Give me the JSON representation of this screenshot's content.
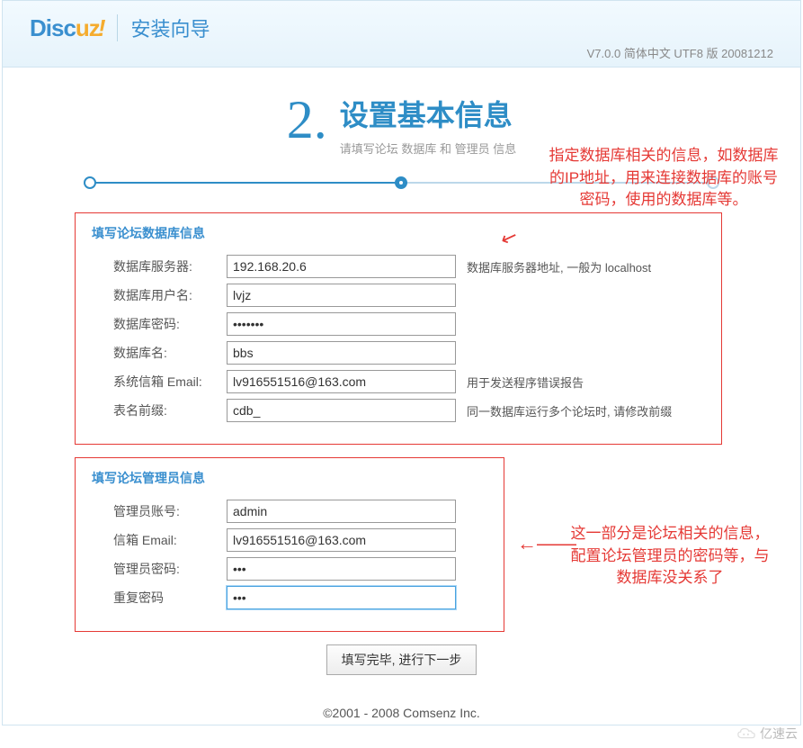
{
  "header": {
    "logo_part1": "Disc",
    "logo_part2": "uz",
    "logo_part3": "!",
    "wizard_label": "安装向导",
    "version": "V7.0.0 简体中文 UTF8 版 20081212"
  },
  "stage": {
    "number": "2.",
    "title": "设置基本信息",
    "subtitle": "请填写论坛 数据库 和 管理员 信息"
  },
  "db_section": {
    "title": "填写论坛数据库信息",
    "rows": {
      "server": {
        "label": "数据库服务器:",
        "value": "192.168.20.6",
        "hint": "数据库服务器地址, 一般为 localhost"
      },
      "user": {
        "label": "数据库用户名:",
        "value": "lvjz",
        "hint": ""
      },
      "pass": {
        "label": "数据库密码:",
        "value": "•••••••",
        "hint": ""
      },
      "name": {
        "label": "数据库名:",
        "value": "bbs",
        "hint": ""
      },
      "email": {
        "label": "系统信箱 Email:",
        "value": "lv916551516@163.com",
        "hint": "用于发送程序错误报告"
      },
      "prefix": {
        "label": "表名前缀:",
        "value": "cdb_",
        "hint": "同一数据库运行多个论坛时, 请修改前缀"
      }
    }
  },
  "admin_section": {
    "title": "填写论坛管理员信息",
    "rows": {
      "account": {
        "label": "管理员账号:",
        "value": "admin"
      },
      "email": {
        "label": "信箱 Email:",
        "value": "lv916551516@163.com"
      },
      "pass": {
        "label": "管理员密码:",
        "value": "•••"
      },
      "repeat": {
        "label": "重复密码",
        "value": "•••"
      }
    }
  },
  "submit_label": "填写完毕, 进行下一步",
  "footer": "©2001 - 2008 Comsenz Inc.",
  "annotations": {
    "anno1": "指定数据库相关的信息，如数据库的IP地址，用来连接数据库的账号密码，使用的数据库等。",
    "anno2": "这一部分是论坛相关的信息，配置论坛管理员的密码等，与数据库没关系了"
  },
  "watermark": "亿速云"
}
